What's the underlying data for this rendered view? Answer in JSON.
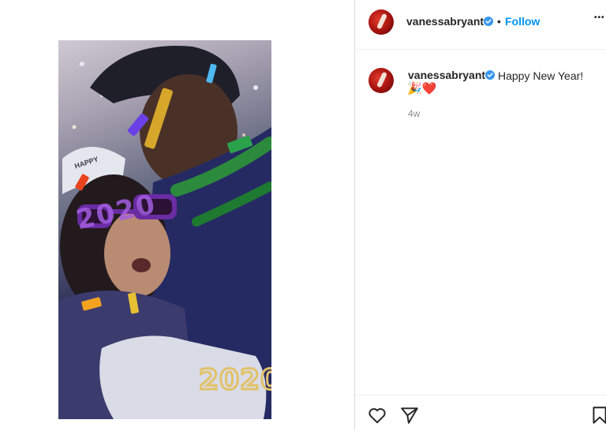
{
  "post": {
    "author": "vanessabryant",
    "follow_label": "Follow",
    "separator": "•",
    "more_label": "•••",
    "caption_text": "Happy New Year!",
    "caption_emojis": "🎉❤️",
    "age": "4w",
    "video_overlay_text": "2020",
    "glasses_text": "2020",
    "hat_text": "HAPPY"
  },
  "icons": {
    "like": "heart-icon",
    "share": "paper-plane-icon",
    "save": "bookmark-icon",
    "verified": "verified-badge-icon"
  },
  "colors": {
    "link": "#0095f6",
    "verified": "#3897f0",
    "text": "#262626",
    "muted": "#8e8e8e"
  }
}
